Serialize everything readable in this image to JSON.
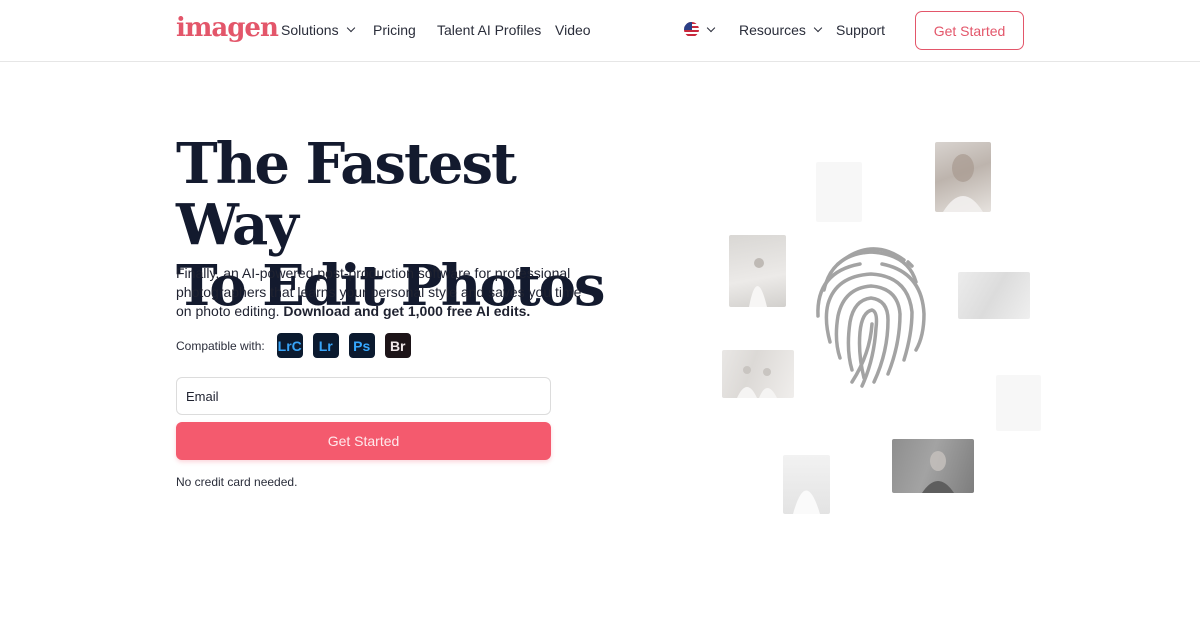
{
  "header": {
    "logo": "imagen",
    "nav": [
      {
        "label": "Solutions",
        "has_dropdown": true
      },
      {
        "label": "Pricing",
        "has_dropdown": false
      },
      {
        "label": "Talent AI Profiles",
        "has_dropdown": false
      },
      {
        "label": "Video",
        "has_dropdown": false
      }
    ],
    "language_icon": "us-flag-icon",
    "resources_label": "Resources",
    "support_label": "Support",
    "cta_label": "Get Started"
  },
  "hero": {
    "title_line1": "The Fastest Way",
    "title_line2": "To Edit Photos",
    "subtitle": "Finally, an AI-powered post-production software for professional photographers that learns your personal style and saves you time on photo editing.",
    "subtitle_bold": "Download and get 1,000 free AI edits.",
    "compatible_label": "Compatible with:",
    "apps": [
      "LrC",
      "Lr",
      "Ps",
      "Br"
    ],
    "email_placeholder": "Email",
    "cta_label": "Get Started",
    "note": "No credit card needed."
  },
  "colors": {
    "brand": "#e3566a",
    "cta": "#f45a6e",
    "heading": "#131a2e"
  }
}
